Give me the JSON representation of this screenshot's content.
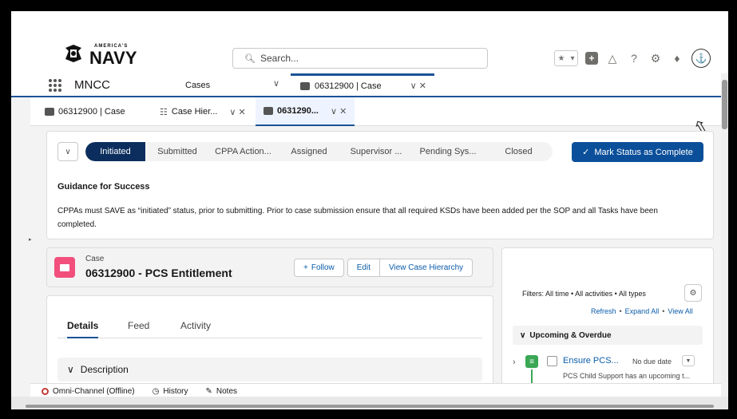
{
  "header": {
    "logo_text": "NAVY",
    "logo_tag": "AMERICA'S",
    "search_placeholder": "Search..."
  },
  "nav": {
    "app_name": "MNCC",
    "item": "Cases",
    "open_tab": "06312900 | Case"
  },
  "subtabs": {
    "tab1": "06312900 | Case",
    "tab2": "Case Hier...",
    "tab3": "0631290..."
  },
  "path": {
    "steps": [
      "Initiated",
      "Submitted",
      "CPPA Action...",
      "Assigned",
      "Supervisor ...",
      "Pending Sys...",
      "Closed"
    ],
    "current": "Initiated",
    "mark_button": "Mark Status as Complete"
  },
  "guidance": {
    "title": "Guidance for Success",
    "text": "CPPAs must SAVE as “initiated” status, prior to submitting. Prior to case submission ensure that all required KSDs have been added per the SOP and all Tasks have been completed."
  },
  "case": {
    "label": "Case",
    "title": "06312900 - PCS Entitlement",
    "follow_btn": "Follow",
    "edit_btn": "Edit",
    "hierarchy_btn": "View Case Hierarchy"
  },
  "details": {
    "tabs": [
      "Details",
      "Feed",
      "Activity"
    ],
    "section": "Description"
  },
  "activity": {
    "filters": "Filters: All time • All activities • All types",
    "refresh": "Refresh",
    "expand_all": "Expand All",
    "view_all": "View All",
    "upcoming": "Upcoming & Overdue",
    "task_title": "Ensure PCS...",
    "task_due": "No due date",
    "task_desc": "PCS Child Support has an upcoming t..."
  },
  "footer": {
    "omni": "Omni-Channel (Offline)",
    "history": "History",
    "notes": "Notes"
  },
  "colors": {
    "brand": "#1b5297",
    "path_current": "#0b2e5e",
    "case_icon": "#f24f7d",
    "task_icon": "#3ba755"
  }
}
